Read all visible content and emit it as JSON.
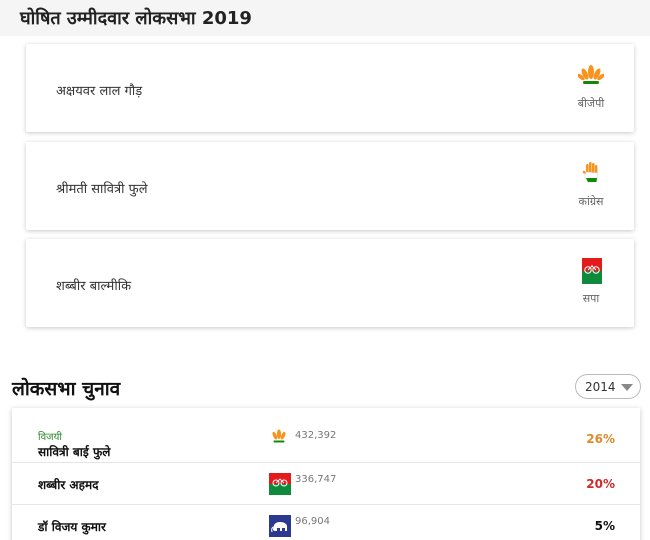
{
  "header": {
    "title": "घोषित उम्मीदवार लोकसभा 2019"
  },
  "candidates": [
    {
      "name": "अक्षयवर लाल गौड़",
      "party": "बीजेपी",
      "logo": "bjp-lotus-icon"
    },
    {
      "name": "श्रीमती सावित्री फुले",
      "party": "कांग्रेस",
      "logo": "congress-hand-icon"
    },
    {
      "name": "शब्बीर बाल्मीकि",
      "party": "सपा",
      "logo": "sp-bicycle-icon"
    }
  ],
  "results": {
    "title": "लोकसभा चुनाव",
    "year": "2014",
    "rows": [
      {
        "tag": "विजयी",
        "name": "सावित्री बाई फुले",
        "logo": "bjp-lotus-icon",
        "votes": "432,392",
        "pct": "26%",
        "pct_color": "#e08a2a"
      },
      {
        "tag": "",
        "name": "शब्बीर अहमद",
        "logo": "sp-bicycle-icon",
        "votes": "336,747",
        "pct": "20%",
        "pct_color": "#d12a2a"
      },
      {
        "tag": "",
        "name": "डॉ विजय कुमार",
        "logo": "bsp-elephant-icon",
        "votes": "96,904",
        "pct": "5%",
        "pct_color": "#111111"
      }
    ]
  },
  "colors": {
    "bjp_saffron": "#f7931e",
    "bjp_green": "#138808",
    "sp_red": "#e41b1b",
    "sp_green": "#0f8a3c",
    "bsp_blue": "#2b3a8f"
  }
}
